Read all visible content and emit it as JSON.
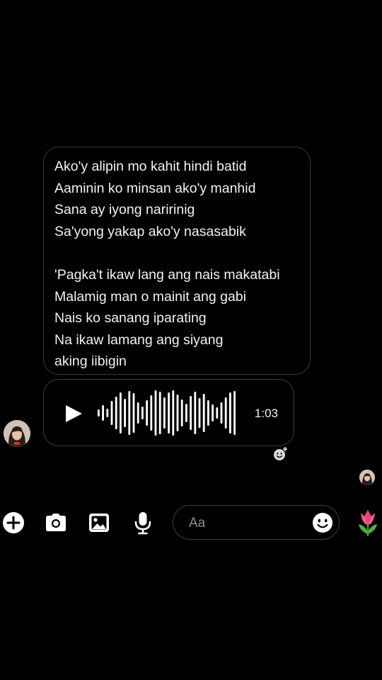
{
  "message": {
    "lines": [
      "Ako'y alipin mo kahit hindi batid",
      "Aaminin ko minsan ako'y manhid",
      "Sana ay iyong naririnig",
      "Sa'yong yakap ako'y nasasabik",
      "",
      "'Pagka't ikaw lang ang nais makatabi",
      "Malamig man o mainit ang gabi",
      "Nais ko sanang iparating",
      "Na ikaw lamang ang siyang",
      "aking iibigin"
    ]
  },
  "voice_message": {
    "duration": "1:03",
    "play_icon": "play-icon"
  },
  "composer": {
    "placeholder": "Aa"
  },
  "toolbar": {
    "icons": [
      "add-icon",
      "camera-icon",
      "gallery-icon",
      "microphone-icon"
    ],
    "emoji_icon": "smiley-icon",
    "quick_reaction": "tulip-icon"
  },
  "colors": {
    "background": "#000000",
    "bubble_border": "#3a3a3a",
    "text": "#f2f2f2",
    "placeholder": "#8e8e8e"
  }
}
